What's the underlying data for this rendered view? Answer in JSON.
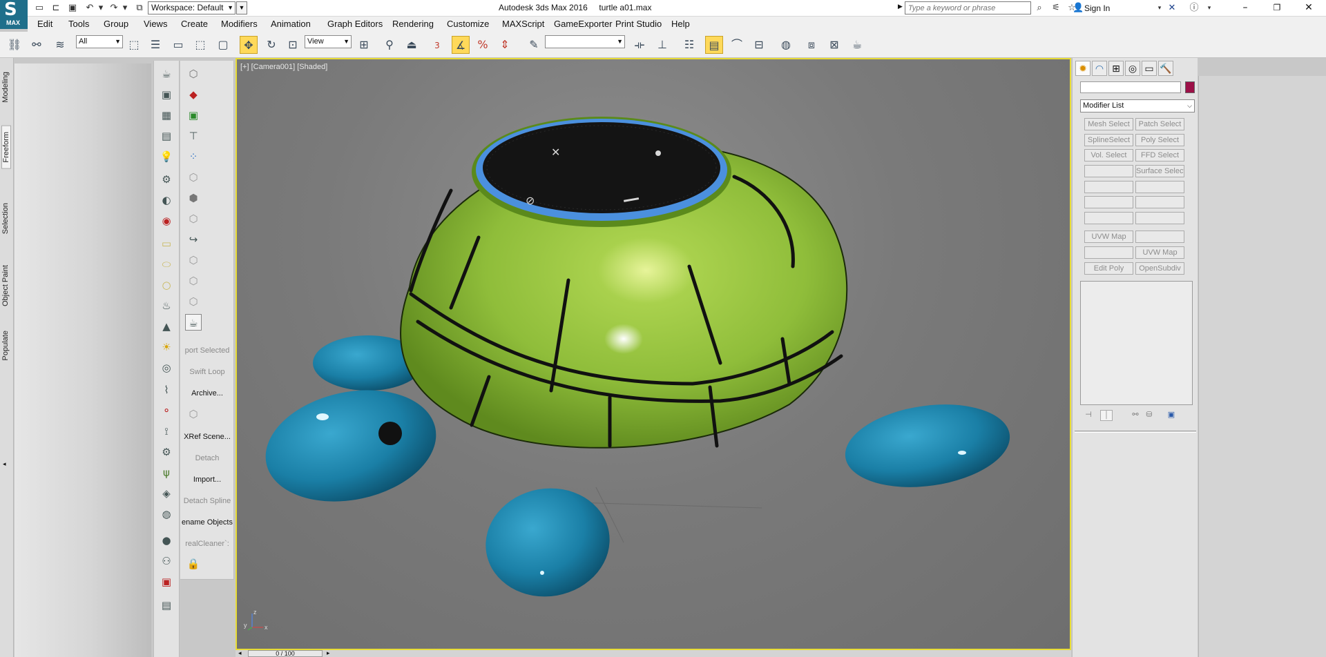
{
  "titlebar": {
    "app_logo_text": "MAX",
    "workspace": "Workspace: Default",
    "title": "Autodesk 3ds Max 2016     turtle a01.max",
    "search_placeholder": "Type a keyword or phrase",
    "sign_in": "Sign In"
  },
  "menu": [
    "Edit",
    "Tools",
    "Group",
    "Views",
    "Create",
    "Modifiers",
    "Animation",
    "Graph Editors",
    "Rendering",
    "Customize",
    "MAXScript",
    "GameExporter",
    "Print Studio",
    "Help"
  ],
  "toolbar": {
    "selection_filter": "All",
    "reference_coord": "View",
    "snap_value": "3",
    "named_selection": ""
  },
  "ribbon_tabs": [
    "Modeling",
    "Freeform",
    "Selection",
    "Object Paint",
    "Populate"
  ],
  "ribbon_active_tab": "Freeform",
  "side_panel": {
    "items": [
      {
        "label": "port Selected",
        "enabled": false
      },
      {
        "label": "Swift Loop",
        "enabled": false
      },
      {
        "label": "Archive...",
        "enabled": true
      },
      {
        "label": "XRef Scene...",
        "enabled": true
      },
      {
        "label": "Detach",
        "enabled": false
      },
      {
        "label": "Import...",
        "enabled": true
      },
      {
        "label": "Detach Spline",
        "enabled": false
      },
      {
        "label": "ename Objects",
        "enabled": true
      },
      {
        "label": "realCleaner`:",
        "enabled": false
      }
    ]
  },
  "viewport": {
    "label": "[+] [Camera001] [Shaded]",
    "axis_labels": {
      "x": "x",
      "y": "y",
      "z": "z"
    },
    "colors": {
      "shell": "#8fbd3a",
      "body": "#1a7fa6",
      "ring": "#4b90de",
      "top": "#141414",
      "background": "#7a7a7a",
      "border": "#e8dc35"
    }
  },
  "timeline": {
    "frame": "0 / 100"
  },
  "command_panel": {
    "name_value": "",
    "object_color": "#9c1047",
    "modifier_list": "Modifier List",
    "modifier_buttons": [
      [
        "Mesh Select",
        "Patch Select"
      ],
      [
        "SplineSelect",
        "Poly Select"
      ],
      [
        "Vol. Select",
        "FFD Select"
      ],
      [
        "",
        "Surface Select"
      ],
      [
        "",
        ""
      ],
      [
        "",
        ""
      ],
      [
        "",
        ""
      ],
      [
        "UVW Map",
        ""
      ],
      [
        "",
        "UVW Map"
      ],
      [
        "Edit Poly",
        "OpenSubdiv"
      ]
    ]
  }
}
